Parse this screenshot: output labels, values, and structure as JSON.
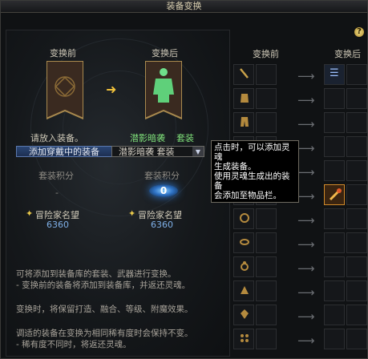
{
  "window": {
    "title": "装备变换",
    "help": "?"
  },
  "left": {
    "before_label": "变换前",
    "after_label": "变换后",
    "prompt": "请放入装备。",
    "result_name": "潜影暗袭",
    "result_type": "套装",
    "dropdown1": "添加穿戴中的装备",
    "dropdown2": "潜影暗袭  套装",
    "score_label_before": "套装积分",
    "score_label_after": "套装积分",
    "score_before": "-",
    "score_after": "0",
    "rep_before_label": "冒险家名望",
    "rep_before_value": "6360",
    "rep_after_label": "冒险家名望",
    "rep_after_value": "6360",
    "info_lines": [
      "可将添加到装备库的套装、武器进行变换。",
      "- 变换前的装备将添加到装备库，并返还灵魂。",
      "变换时，将保留打造、融合、等级、附魔效果。",
      "调适的装备在变换为相同稀有度时会保持不变。",
      "- 稀有度不同时，将返还灵魂。"
    ]
  },
  "tooltip": {
    "lines": [
      "点击时，可以添加灵魂",
      "生成装备。",
      "使用灵魂生成出的装备",
      "会添加至物品栏。"
    ]
  },
  "right": {
    "before_label": "变换前",
    "after_label": "变换后",
    "rows": [
      {
        "icon": "weapon-icon"
      },
      {
        "icon": "top-icon"
      },
      {
        "icon": "pants-icon"
      },
      {
        "icon": "shoulder-icon"
      },
      {
        "icon": "belt-icon"
      },
      {
        "icon": "shoes-icon"
      },
      {
        "icon": "necklace-icon"
      },
      {
        "icon": "bracelet-icon"
      },
      {
        "icon": "ring-icon"
      },
      {
        "icon": "sub-equip-icon"
      },
      {
        "icon": "magic-stone-icon"
      },
      {
        "icon": "earring-icon"
      }
    ]
  },
  "colors": {
    "green": "#7fe07a",
    "gold": "#e8c84a",
    "blue_text": "#7fb0e8",
    "tooltip_bg": "#000000"
  }
}
